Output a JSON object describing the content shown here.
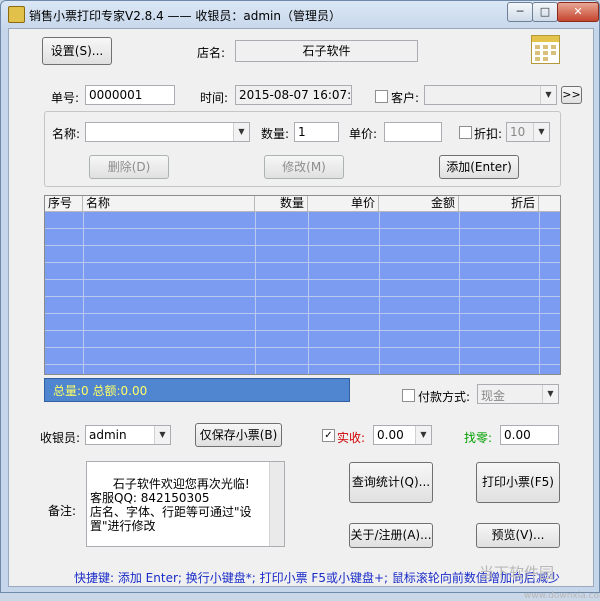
{
  "window": {
    "title": "销售小票打印专家V2.8.4 —— 收银员：admin（管理员）",
    "min_glyph": "─",
    "max_glyph": "□",
    "close_glyph": "✕"
  },
  "header": {
    "settings_label": "设置(S)...",
    "store_label": "店名:",
    "store_value": "石子软件"
  },
  "order": {
    "number_label": "单号:",
    "number_value": "0000001",
    "time_label": "时间:",
    "time_value": "2015-08-07 16:07:20",
    "customer_label": "客户:",
    "customer_value": "",
    "more_label": ">>"
  },
  "item_entry": {
    "name_label": "名称:",
    "name_value": "",
    "qty_label": "数量:",
    "qty_value": "1",
    "price_label": "单价:",
    "price_value": "",
    "discount_label": "折扣:",
    "discount_value": "10",
    "delete_label": "删除(D)",
    "modify_label": "修改(M)",
    "add_label": "添加(Enter)"
  },
  "grid": {
    "columns": [
      "序号",
      "名称",
      "数量",
      "单价",
      "金额",
      "折后"
    ]
  },
  "summary": {
    "text": "总量:0  总额:0.00"
  },
  "payment": {
    "method_label": "付款方式:",
    "method_value": "现金"
  },
  "cashier": {
    "label": "收银员:",
    "value": "admin",
    "save_only_label": "仅保存小票(B)",
    "received_label": "实收:",
    "received_value": "0.00",
    "change_label": "找零:",
    "change_value": "0.00"
  },
  "remarks": {
    "label": "备注:",
    "text": "石子软件欢迎您再次光临!\n客服QQ: 842150305\n店名、字体、行距等可通过\"设置\"进行修改"
  },
  "actions": {
    "query_label": "查询统计(Q)...",
    "print_label": "打印小票(F5)",
    "about_label": "关于/注册(A)...",
    "preview_label": "预览(V)..."
  },
  "footer": {
    "shortcut_text": "快捷键:  添加 Enter; 换行小键盘*; 打印小票 F5或小键盘+; 鼠标滚轮向前数值增加向后减少"
  },
  "watermark": {
    "text": "当下软件园",
    "url": "www.downxia.com"
  },
  "colors": {
    "grid_bg": "#7b9cf0",
    "summary_bg": "#4f86cf",
    "summary_text": "#ffff66",
    "received_label": "#d00000",
    "change_label": "#00a000",
    "shortcut_text": "#1a2cc8"
  }
}
